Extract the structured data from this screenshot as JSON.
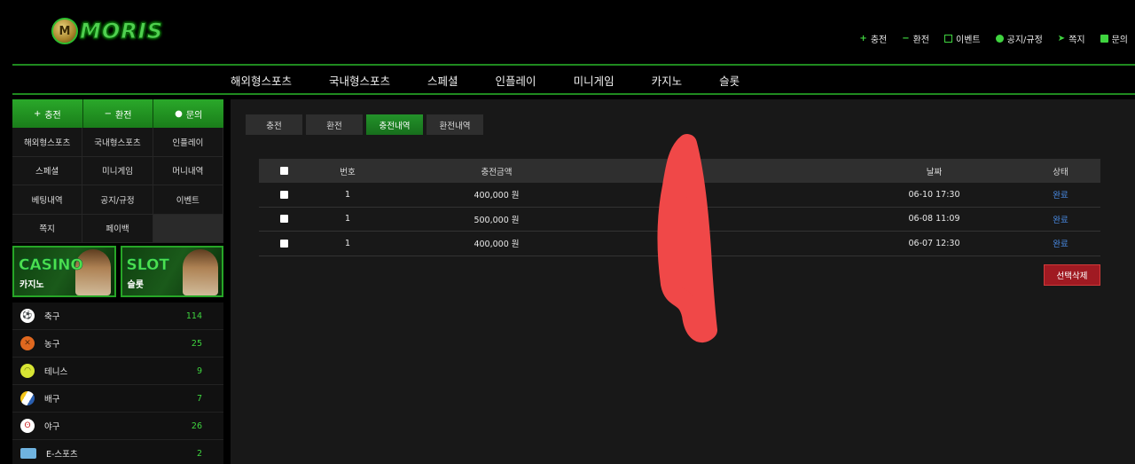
{
  "brand": {
    "logo_letter": "M",
    "logo_text": "MORIS"
  },
  "top_links": [
    {
      "icon": "plus-icon",
      "label": "충전"
    },
    {
      "icon": "minus-icon",
      "label": "환전"
    },
    {
      "icon": "calendar-icon",
      "label": "이벤트"
    },
    {
      "icon": "notice-icon",
      "label": "공지/규정"
    },
    {
      "icon": "send-icon",
      "label": "쪽지"
    },
    {
      "icon": "checkbox-icon",
      "label": "문의"
    }
  ],
  "main_nav": [
    "해외형스포츠",
    "국내형스포츠",
    "스페셜",
    "인플레이",
    "미니게임",
    "카지노",
    "슬롯"
  ],
  "sidebar": {
    "quick": [
      {
        "icon": "+",
        "label": "충전"
      },
      {
        "icon": "−",
        "label": "환전"
      },
      {
        "icon": "●",
        "label": "문의"
      }
    ],
    "grid": [
      "해외형스포츠",
      "국내형스포츠",
      "인플레이",
      "스페셜",
      "미니게임",
      "머니내역",
      "베팅내역",
      "공지/규정",
      "이벤트",
      "쪽지",
      "페이백",
      ""
    ],
    "banners": [
      {
        "title": "CASINO",
        "sub": "카지노"
      },
      {
        "title": "SLOT",
        "sub": "슬롯"
      }
    ],
    "sports": [
      {
        "icon": "soccer-ball-icon",
        "name": "축구",
        "count": "114"
      },
      {
        "icon": "basketball-icon",
        "name": "농구",
        "count": "25"
      },
      {
        "icon": "tennis-ball-icon",
        "name": "테니스",
        "count": "9"
      },
      {
        "icon": "volleyball-icon",
        "name": "배구",
        "count": "7"
      },
      {
        "icon": "baseball-icon",
        "name": "야구",
        "count": "26"
      },
      {
        "icon": "esports-icon",
        "name": "E-스포츠",
        "count": "2"
      }
    ]
  },
  "tabs": [
    {
      "label": "충전",
      "active": false
    },
    {
      "label": "환전",
      "active": false
    },
    {
      "label": "충전내역",
      "active": true
    },
    {
      "label": "환전내역",
      "active": false
    }
  ],
  "table": {
    "headers": {
      "no": "번호",
      "amount": "충전금액",
      "date": "날짜",
      "status": "상태"
    },
    "rows": [
      {
        "no": "1",
        "amount": "400,000 원",
        "date": "06-10 17:30",
        "status": "완료"
      },
      {
        "no": "1",
        "amount": "500,000 원",
        "date": "06-08 11:09",
        "status": "완료"
      },
      {
        "no": "1",
        "amount": "400,000 원",
        "date": "06-07 12:30",
        "status": "완료"
      }
    ]
  },
  "delete_button": "선택삭제",
  "colors": {
    "accent_green": "#1f8a1f",
    "link_blue": "#4a8de8",
    "delete_red": "#a01a22",
    "redaction": "#f04848"
  }
}
